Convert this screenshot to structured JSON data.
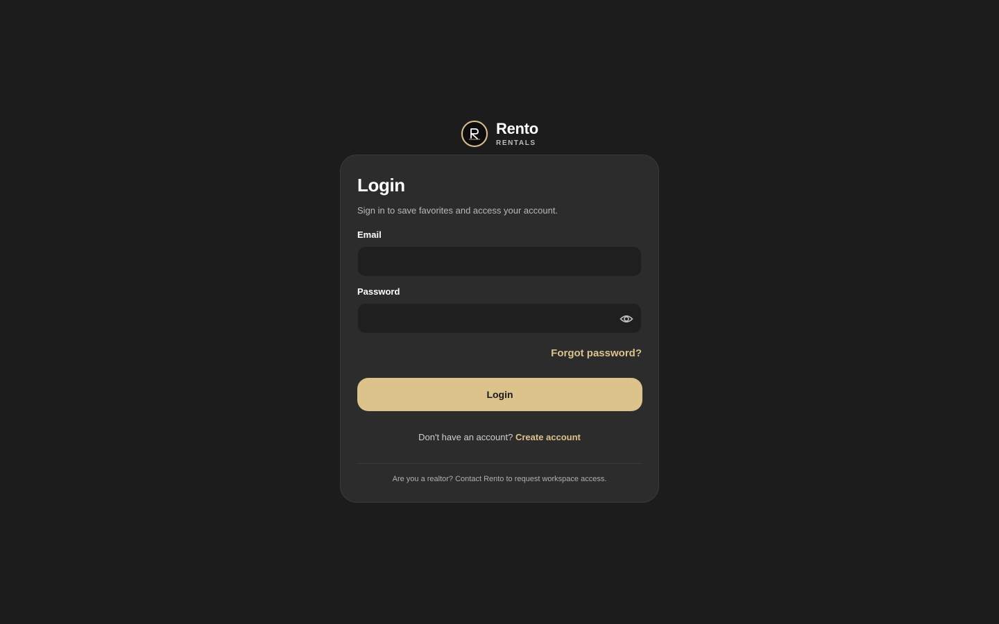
{
  "brand": {
    "name": "Rento",
    "subtitle": "RENTALS"
  },
  "login": {
    "title": "Login",
    "subtitle": "Sign in to save favorites and access your account.",
    "email_label": "Email",
    "email_value": "",
    "password_label": "Password",
    "password_value": "",
    "forgot_label": "Forgot password?",
    "submit_label": "Login",
    "signup_prompt": "Don't have an account?",
    "signup_link": "Create account",
    "footnote": "Are you a realtor? Contact Rento to request workspace access."
  },
  "icons": {
    "logo": "rento-logo-icon",
    "password_toggle": "eye-icon"
  },
  "colors": {
    "background": "#1c1c1c",
    "card": "#2c2c2c",
    "input": "#1f1f1f",
    "accent": "#dcc28b"
  }
}
